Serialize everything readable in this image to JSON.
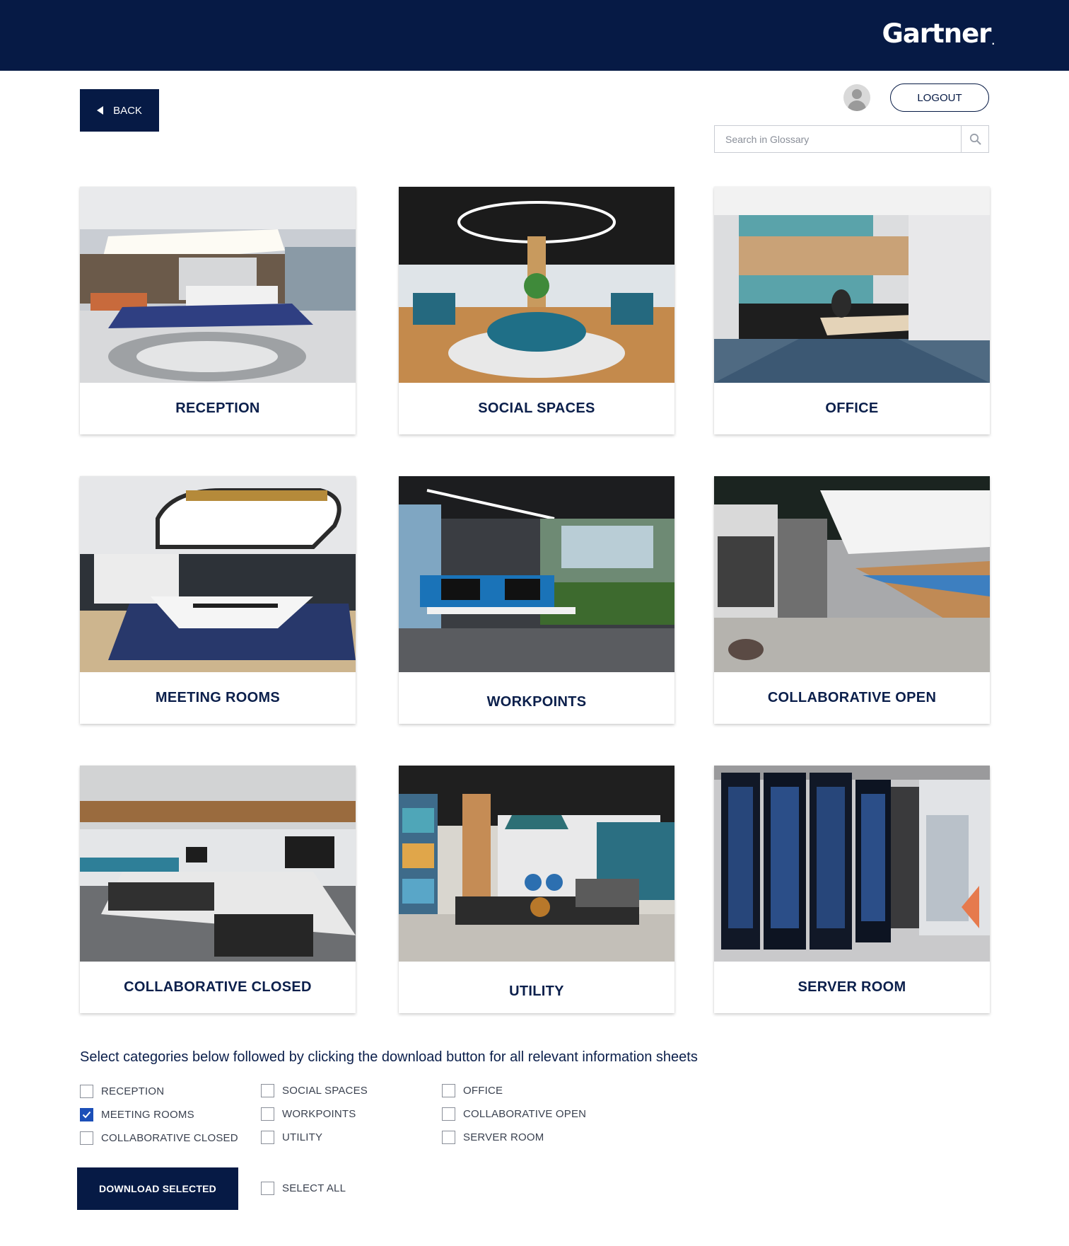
{
  "header": {
    "logo_text": "Gartner",
    "logo_dot": "."
  },
  "back_button": {
    "label": "BACK",
    "icon": "chevron-left-icon"
  },
  "user": {
    "avatar_icon": "user-avatar-icon",
    "logout_label": "LOGOUT"
  },
  "search": {
    "placeholder": "Search in Glossary",
    "value": "",
    "icon": "search-icon"
  },
  "categories": [
    {
      "label": "RECEPTION"
    },
    {
      "label": "SOCIAL SPACES"
    },
    {
      "label": "OFFICE"
    },
    {
      "label": "MEETING ROOMS"
    },
    {
      "label": "WORKPOINTS"
    },
    {
      "label": "COLLABORATIVE OPEN"
    },
    {
      "label": "COLLABORATIVE CLOSED"
    },
    {
      "label": "UTILITY"
    },
    {
      "label": "SERVER ROOM"
    }
  ],
  "instructions": "Select categories below followed by clicking the download button for all relevant information sheets",
  "checkboxes": [
    {
      "label": "RECEPTION",
      "checked": false
    },
    {
      "label": "SOCIAL SPACES",
      "checked": false
    },
    {
      "label": "OFFICE",
      "checked": false
    },
    {
      "label": "MEETING ROOMS",
      "checked": true
    },
    {
      "label": "WORKPOINTS",
      "checked": false
    },
    {
      "label": "COLLABORATIVE OPEN",
      "checked": false
    },
    {
      "label": "COLLABORATIVE CLOSED",
      "checked": false
    },
    {
      "label": "UTILITY",
      "checked": false
    },
    {
      "label": "SERVER ROOM",
      "checked": false
    }
  ],
  "download_button": {
    "label": "DOWNLOAD SELECTED"
  },
  "select_all": {
    "label": "SELECT ALL",
    "checked": false
  },
  "colors": {
    "navy": "#061a45",
    "heading": "#0b1f4b",
    "check_blue": "#1c4fb8"
  }
}
